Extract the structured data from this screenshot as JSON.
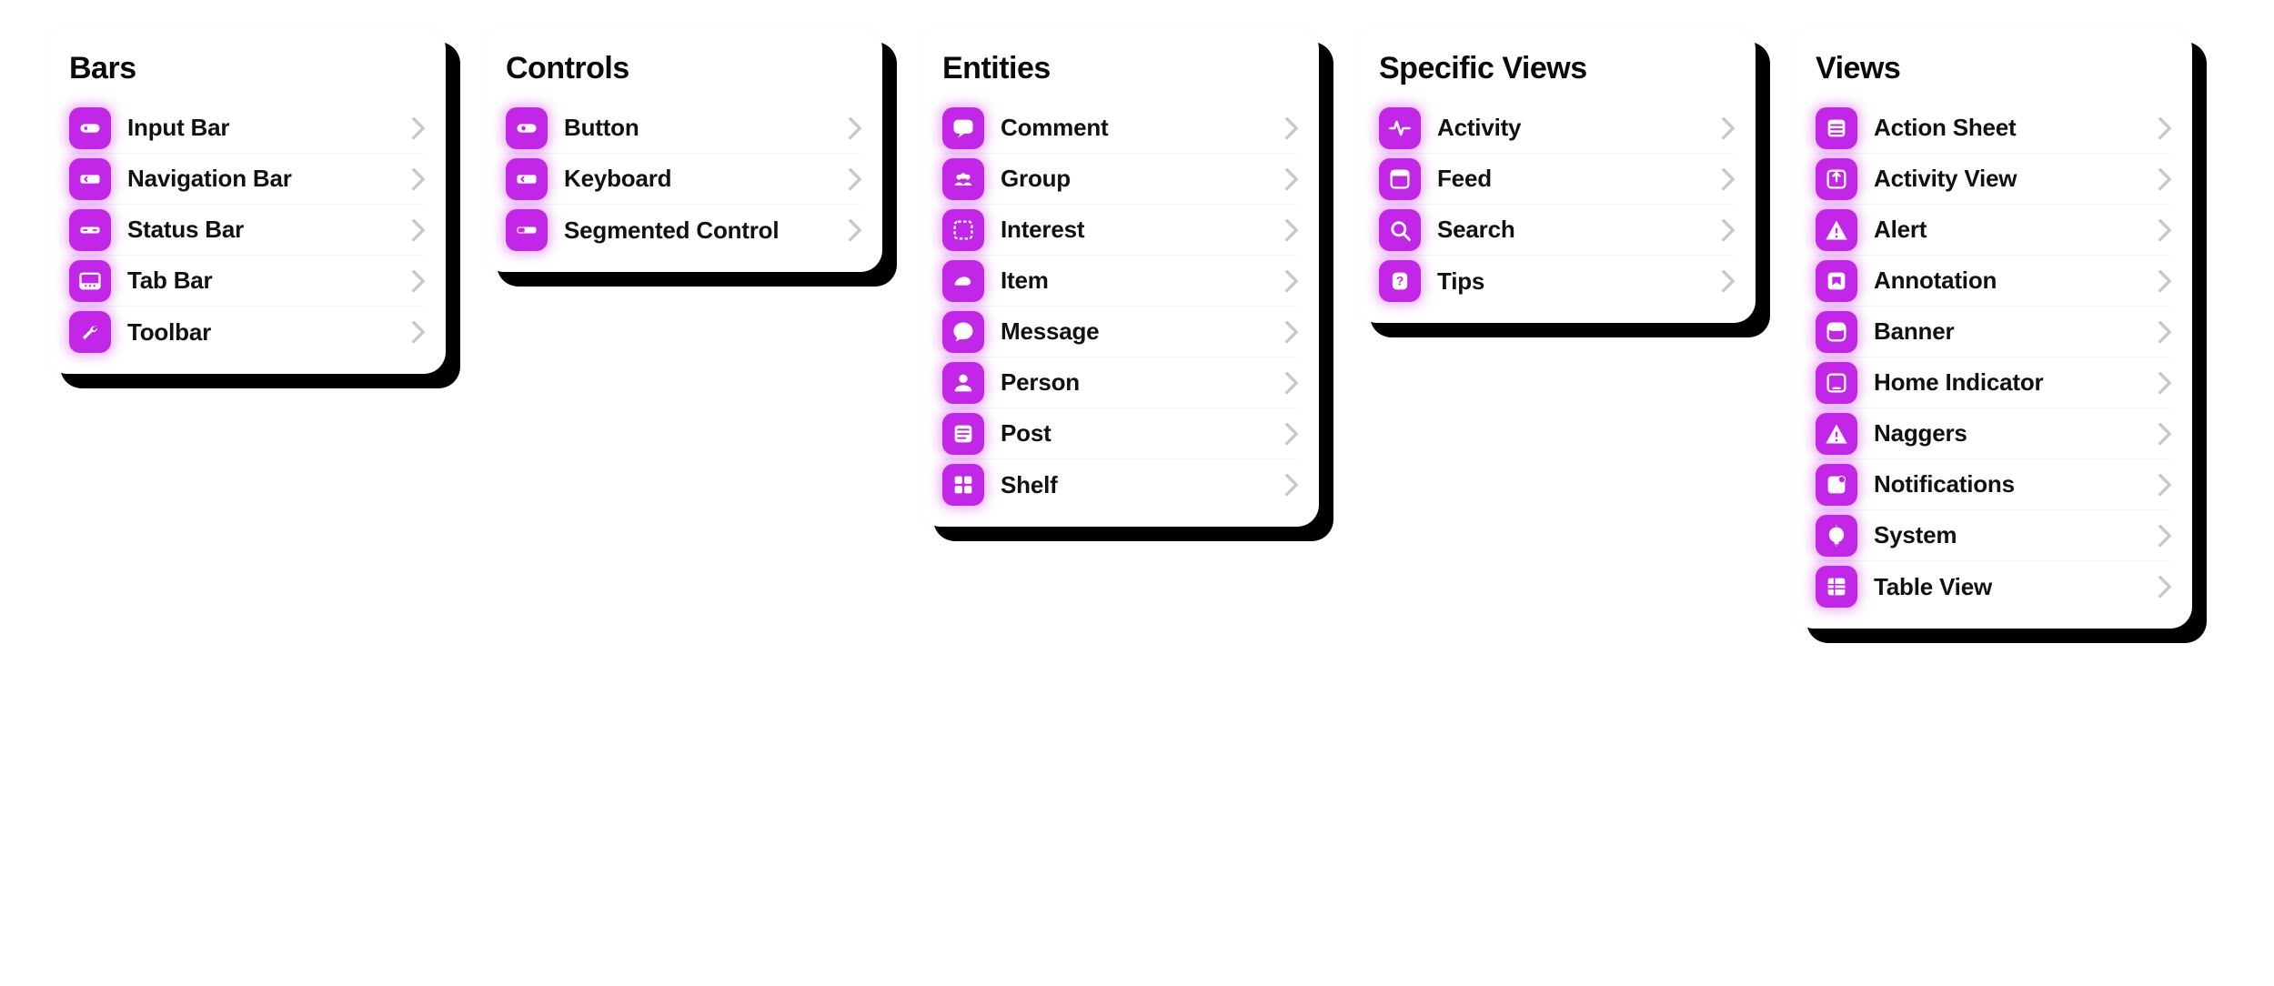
{
  "colors": {
    "accent": "#c226e6",
    "card_bg": "#ffffff",
    "shadow": "#000000",
    "chevron": "#c9c9cc"
  },
  "columns": [
    {
      "title": "Bars",
      "items": [
        {
          "label": "Input Bar",
          "icon": "input-bar-icon"
        },
        {
          "label": "Navigation Bar",
          "icon": "navigation-bar-icon"
        },
        {
          "label": "Status Bar",
          "icon": "status-bar-icon"
        },
        {
          "label": "Tab Bar",
          "icon": "tab-bar-icon"
        },
        {
          "label": "Toolbar",
          "icon": "toolbar-icon"
        }
      ]
    },
    {
      "title": "Controls",
      "items": [
        {
          "label": "Button",
          "icon": "button-icon"
        },
        {
          "label": "Keyboard",
          "icon": "keyboard-icon"
        },
        {
          "label": "Segmented Control",
          "icon": "segmented-control-icon"
        }
      ]
    },
    {
      "title": "Entities",
      "items": [
        {
          "label": "Comment",
          "icon": "comment-icon"
        },
        {
          "label": "Group",
          "icon": "group-icon"
        },
        {
          "label": "Interest",
          "icon": "interest-icon"
        },
        {
          "label": "Item",
          "icon": "item-icon"
        },
        {
          "label": "Message",
          "icon": "message-icon"
        },
        {
          "label": "Person",
          "icon": "person-icon"
        },
        {
          "label": "Post",
          "icon": "post-icon"
        },
        {
          "label": "Shelf",
          "icon": "shelf-icon"
        }
      ]
    },
    {
      "title": "Specific Views",
      "items": [
        {
          "label": "Activity",
          "icon": "activity-icon"
        },
        {
          "label": "Feed",
          "icon": "feed-icon"
        },
        {
          "label": "Search",
          "icon": "search-icon"
        },
        {
          "label": "Tips",
          "icon": "tips-icon"
        }
      ]
    },
    {
      "title": "Views",
      "items": [
        {
          "label": "Action Sheet",
          "icon": "action-sheet-icon"
        },
        {
          "label": "Activity View",
          "icon": "activity-view-icon"
        },
        {
          "label": "Alert",
          "icon": "alert-icon"
        },
        {
          "label": "Annotation",
          "icon": "annotation-icon"
        },
        {
          "label": "Banner",
          "icon": "banner-icon"
        },
        {
          "label": "Home Indicator",
          "icon": "home-indicator-icon"
        },
        {
          "label": "Naggers",
          "icon": "naggers-icon"
        },
        {
          "label": "Notifications",
          "icon": "notifications-icon"
        },
        {
          "label": "System",
          "icon": "system-icon"
        },
        {
          "label": "Table View",
          "icon": "table-view-icon"
        }
      ]
    }
  ]
}
